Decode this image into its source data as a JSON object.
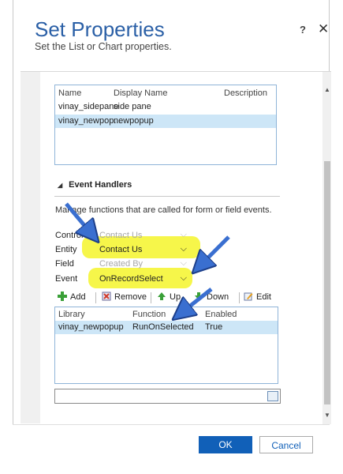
{
  "dialog": {
    "title": "Set Properties",
    "subtitle": "Set the List or Chart properties.",
    "help_label": "?",
    "close_label": "✕"
  },
  "list_grid": {
    "columns": [
      "Name",
      "Display Name",
      "Description"
    ],
    "rows": [
      {
        "name": "vinay_sidepane",
        "display": "side pane",
        "selected": false
      },
      {
        "name": "vinay_newpop...",
        "display": "newpopup",
        "selected": true
      }
    ]
  },
  "event_handlers": {
    "section_title": "Event Handlers",
    "description": "Manage functions that are called for form or field events.",
    "fields": [
      {
        "label": "Control",
        "value": "Contact Us",
        "disabled": true
      },
      {
        "label": "Entity",
        "value": "Contact Us",
        "disabled": false
      },
      {
        "label": "Field",
        "value": "Created By",
        "disabled": true
      },
      {
        "label": "Event",
        "value": "OnRecordSelect",
        "disabled": false
      }
    ],
    "toolbar": {
      "add": "Add",
      "remove": "Remove",
      "up": "Up",
      "down": "Down",
      "edit": "Edit"
    },
    "grid": {
      "columns": [
        "Library",
        "Function",
        "Enabled"
      ],
      "rows": [
        {
          "library": "vinay_newpopup",
          "function": "RunOnSelected",
          "enabled": "True"
        }
      ]
    }
  },
  "footer": {
    "ok_label": "OK",
    "cancel_label": "Cancel"
  },
  "colors": {
    "title_blue": "#2a5fa6",
    "ok_blue": "#1160b8",
    "highlight_yellow": "#f5f52a",
    "arrow_blue": "#3a6fd0",
    "selected_row": "#cde6f7"
  }
}
